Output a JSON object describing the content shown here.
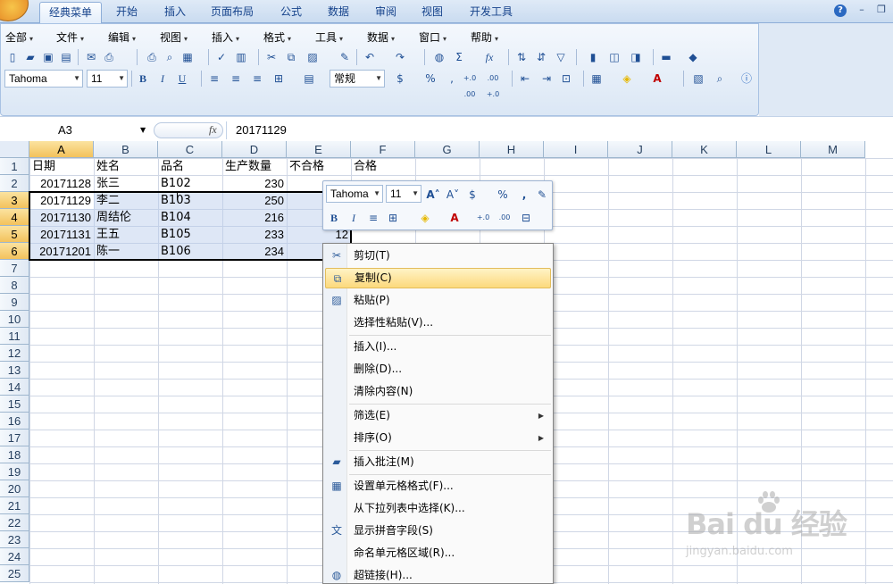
{
  "ribbon_tabs": [
    "经典菜单",
    "开始",
    "插入",
    "页面布局",
    "公式",
    "数据",
    "审阅",
    "视图",
    "开发工具"
  ],
  "classic_menu": [
    "全部",
    "文件",
    "编辑",
    "视图",
    "插入",
    "格式",
    "工具",
    "数据",
    "窗口",
    "帮助"
  ],
  "toolbar": {
    "font_name": "Tahoma",
    "font_size": "11",
    "number_format": "常规",
    "bold": "B",
    "italic": "I",
    "underline": "U",
    "sum": "Σ",
    "fx": "fx",
    "percent": "%",
    "comma": ",",
    "inc_dec": "+.0 .00",
    "dec_dec": ".00 +.0"
  },
  "formula_bar": {
    "name_box": "A3",
    "fx_label": "fx",
    "formula": "20171129"
  },
  "columns": [
    "A",
    "B",
    "C",
    "D",
    "E",
    "F",
    "G",
    "H",
    "I",
    "J",
    "K",
    "L",
    "M"
  ],
  "rows": [
    "1",
    "2",
    "3",
    "4",
    "5",
    "6",
    "7",
    "8",
    "9",
    "10",
    "11",
    "12",
    "13",
    "14",
    "15",
    "16",
    "17",
    "18",
    "19",
    "20",
    "21",
    "22",
    "23",
    "24",
    "25"
  ],
  "sheet": {
    "headers": [
      "日期",
      "姓名",
      "品名",
      "生产数量",
      "不合格",
      "合格"
    ],
    "data": [
      [
        "20171128",
        "张三",
        "B102",
        "230",
        "",
        ""
      ],
      [
        "20171129",
        "李二",
        "B103",
        "250",
        "",
        ""
      ],
      [
        "20171130",
        "周结伦",
        "B104",
        "216",
        "",
        ""
      ],
      [
        "20171131",
        "王五",
        "B105",
        "233",
        "12",
        ""
      ],
      [
        "20171201",
        "陈一",
        "B106",
        "234",
        "",
        ""
      ]
    ]
  },
  "mini_toolbar": {
    "font_name": "Tahoma",
    "font_size": "11",
    "bold": "B",
    "italic": "I",
    "percent": "%",
    "comma": ","
  },
  "context_menu": [
    {
      "label": "剪切(T)",
      "icon": "scissors-icon"
    },
    {
      "label": "复制(C)",
      "icon": "copy-icon",
      "highlighted": true
    },
    {
      "label": "粘贴(P)",
      "icon": "paste-icon"
    },
    {
      "label": "选择性粘贴(V)...",
      "icon": ""
    },
    {
      "label": "插入(I)...",
      "icon": ""
    },
    {
      "label": "删除(D)...",
      "icon": ""
    },
    {
      "label": "清除内容(N)",
      "icon": ""
    },
    {
      "label": "筛选(E)",
      "icon": "",
      "submenu": true
    },
    {
      "label": "排序(O)",
      "icon": "",
      "submenu": true
    },
    {
      "label": "插入批注(M)",
      "icon": "comment-icon"
    },
    {
      "label": "设置单元格格式(F)...",
      "icon": "format-cells-icon"
    },
    {
      "label": "从下拉列表中选择(K)...",
      "icon": ""
    },
    {
      "label": "显示拼音字段(S)",
      "icon": "phonetic-icon"
    },
    {
      "label": "命名单元格区域(R)...",
      "icon": ""
    },
    {
      "label": "超链接(H)...",
      "icon": "hyperlink-icon"
    }
  ],
  "watermark": {
    "main": "Bai du 经验",
    "sub": "jingyan.baidu.com"
  },
  "colors": {
    "selection_header": "#f3c25c",
    "menu_highlight": "#fcd97c",
    "grid_line": "#d0d7e5"
  }
}
